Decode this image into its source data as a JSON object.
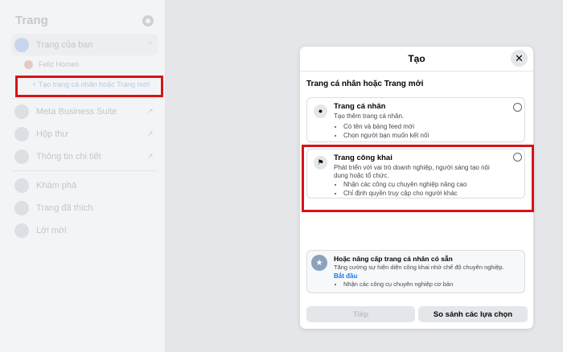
{
  "sidebar": {
    "title": "Trang",
    "icons": {
      "settings": "gear-icon"
    },
    "your_pages": {
      "label": "Trang của bạn",
      "expanded": true
    },
    "page_item": "Feliz Homes",
    "create_link": "+ Tạo trang cá nhân hoặc Trang mới",
    "items": [
      {
        "label": "Meta Business Suite",
        "icon": "meta-icon"
      },
      {
        "label": "Hộp thư",
        "icon": "inbox-icon"
      },
      {
        "label": "Thông tin chi tiết",
        "icon": "insights-icon"
      }
    ],
    "bottom_items": [
      {
        "label": "Khám phá",
        "icon": "compass-icon"
      },
      {
        "label": "Trang đã thích",
        "icon": "thumbs-up-icon"
      },
      {
        "label": "Lời mời",
        "icon": "person-add-icon"
      }
    ]
  },
  "modal": {
    "title": "Tạo",
    "close_symbol": "✕",
    "section_label": "Trang cá nhân hoặc Trang mới",
    "options": [
      {
        "title": "Trang cá nhân",
        "description": "Tạo thêm trang cá nhân.",
        "bullets": [
          "Có tên và bảng feed mới",
          "Chọn người bạn muốn kết nối"
        ],
        "icon": "person-icon",
        "selected": false
      },
      {
        "title": "Trang công khai",
        "description": "Phát triển với vai trò doanh nghiệp, người sáng tạo nội dung hoặc tổ chức.",
        "bullets": [
          "Nhận các công cụ chuyên nghiệp nâng cao",
          "Chỉ định quyền truy cập cho người khác"
        ],
        "icon": "flag-icon",
        "selected": false
      }
    ],
    "upgrade": {
      "title": "Hoặc nâng cấp trang cá nhân có sẵn",
      "description": "Tăng cường sự hiện diện công khai nhờ chế độ chuyên nghiệp.",
      "link": "Bắt đầu",
      "bullets": [
        "Nhận các công cụ chuyên nghiệp cơ bản"
      ]
    },
    "buttons": {
      "next": "Tiếp",
      "compare": "So sánh các lựa chọn"
    }
  },
  "colors": {
    "highlight": "#d6141a",
    "link": "#1877f2",
    "button_bg": "#e4e6eb"
  }
}
